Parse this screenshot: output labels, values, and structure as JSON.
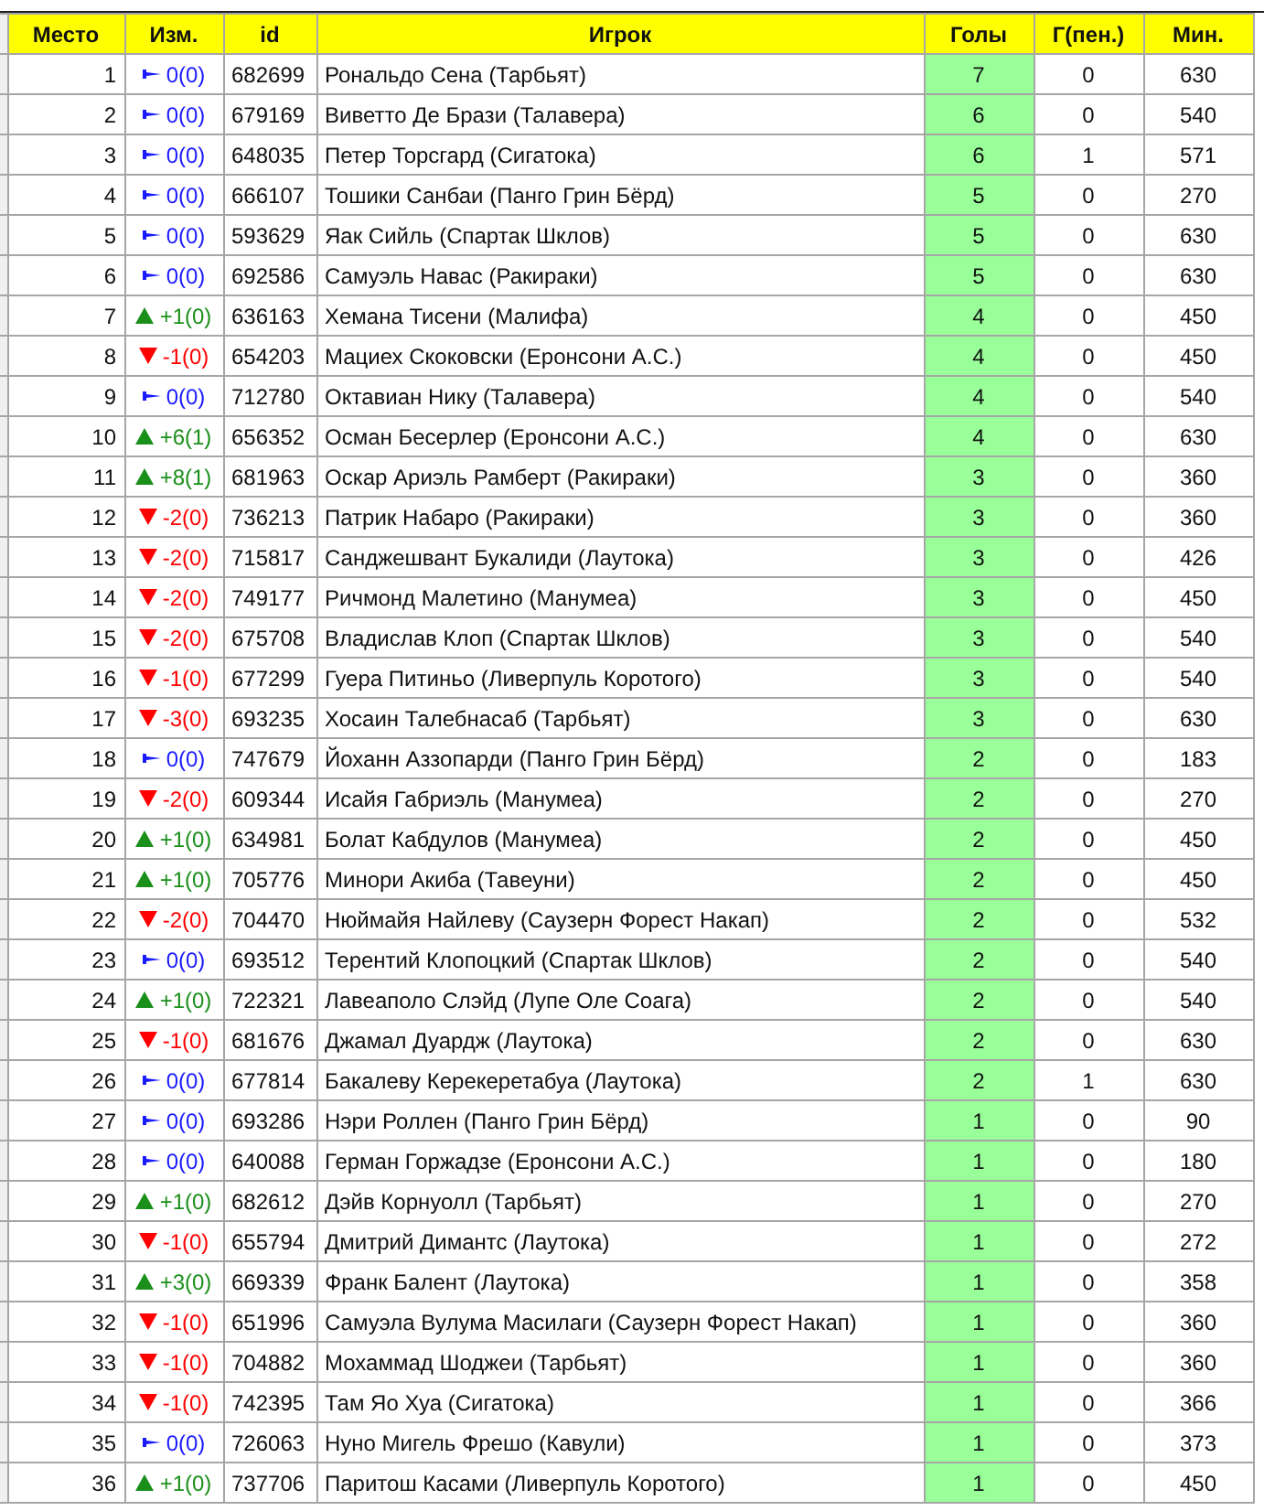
{
  "table": {
    "columns": [
      "Место",
      "Изм.",
      "id",
      "Игрок",
      "Голы",
      "Г(пен.)",
      "Мин."
    ],
    "rows": [
      {
        "place": "1",
        "kind": "same",
        "change": "0(0)",
        "id": "682699",
        "player": "Рональдо Сена (Тарбьят)",
        "goals": "7",
        "pen": "0",
        "min": "630"
      },
      {
        "place": "2",
        "kind": "same",
        "change": "0(0)",
        "id": "679169",
        "player": "Виветто Де Брази (Талавера)",
        "goals": "6",
        "pen": "0",
        "min": "540"
      },
      {
        "place": "3",
        "kind": "same",
        "change": "0(0)",
        "id": "648035",
        "player": "Петер Торсгард (Сигатока)",
        "goals": "6",
        "pen": "1",
        "min": "571"
      },
      {
        "place": "4",
        "kind": "same",
        "change": "0(0)",
        "id": "666107",
        "player": "Тошики Санбаи (Панго Грин Бёрд)",
        "goals": "5",
        "pen": "0",
        "min": "270"
      },
      {
        "place": "5",
        "kind": "same",
        "change": "0(0)",
        "id": "593629",
        "player": "Яак Сийль (Спартак Шклов)",
        "goals": "5",
        "pen": "0",
        "min": "630"
      },
      {
        "place": "6",
        "kind": "same",
        "change": "0(0)",
        "id": "692586",
        "player": "Самуэль Навас (Ракираки)",
        "goals": "5",
        "pen": "0",
        "min": "630"
      },
      {
        "place": "7",
        "kind": "up",
        "change": "+1(0)",
        "id": "636163",
        "player": "Хемана Тисени (Малифа)",
        "goals": "4",
        "pen": "0",
        "min": "450"
      },
      {
        "place": "8",
        "kind": "down",
        "change": "-1(0)",
        "id": "654203",
        "player": "Мациех Скоковски (Еронсони А.С.)",
        "goals": "4",
        "pen": "0",
        "min": "450"
      },
      {
        "place": "9",
        "kind": "same",
        "change": "0(0)",
        "id": "712780",
        "player": "Октавиан Нику (Талавера)",
        "goals": "4",
        "pen": "0",
        "min": "540"
      },
      {
        "place": "10",
        "kind": "up",
        "change": "+6(1)",
        "id": "656352",
        "player": "Осман Бесерлер (Еронсони А.С.)",
        "goals": "4",
        "pen": "0",
        "min": "630"
      },
      {
        "place": "11",
        "kind": "up",
        "change": "+8(1)",
        "id": "681963",
        "player": "Оскар Ариэль Рамберт (Ракираки)",
        "goals": "3",
        "pen": "0",
        "min": "360"
      },
      {
        "place": "12",
        "kind": "down",
        "change": "-2(0)",
        "id": "736213",
        "player": "Патрик Набаро (Ракираки)",
        "goals": "3",
        "pen": "0",
        "min": "360"
      },
      {
        "place": "13",
        "kind": "down",
        "change": "-2(0)",
        "id": "715817",
        "player": "Санджешвант Букалиди (Лаутока)",
        "goals": "3",
        "pen": "0",
        "min": "426"
      },
      {
        "place": "14",
        "kind": "down",
        "change": "-2(0)",
        "id": "749177",
        "player": "Ричмонд Малетино (Манумеа)",
        "goals": "3",
        "pen": "0",
        "min": "450"
      },
      {
        "place": "15",
        "kind": "down",
        "change": "-2(0)",
        "id": "675708",
        "player": "Владислав Клоп (Спартак Шклов)",
        "goals": "3",
        "pen": "0",
        "min": "540"
      },
      {
        "place": "16",
        "kind": "down",
        "change": "-1(0)",
        "id": "677299",
        "player": "Гуера Питиньо (Ливерпуль Коротого)",
        "goals": "3",
        "pen": "0",
        "min": "540"
      },
      {
        "place": "17",
        "kind": "down",
        "change": "-3(0)",
        "id": "693235",
        "player": "Хосаин Талебнасаб (Тарбьят)",
        "goals": "3",
        "pen": "0",
        "min": "630"
      },
      {
        "place": "18",
        "kind": "same",
        "change": "0(0)",
        "id": "747679",
        "player": "Йоханн Аззопарди (Панго Грин Бёрд)",
        "goals": "2",
        "pen": "0",
        "min": "183"
      },
      {
        "place": "19",
        "kind": "down",
        "change": "-2(0)",
        "id": "609344",
        "player": "Исайя Габриэль (Манумеа)",
        "goals": "2",
        "pen": "0",
        "min": "270"
      },
      {
        "place": "20",
        "kind": "up",
        "change": "+1(0)",
        "id": "634981",
        "player": "Болат Кабдулов (Манумеа)",
        "goals": "2",
        "pen": "0",
        "min": "450"
      },
      {
        "place": "21",
        "kind": "up",
        "change": "+1(0)",
        "id": "705776",
        "player": "Минори Акиба (Тавеуни)",
        "goals": "2",
        "pen": "0",
        "min": "450"
      },
      {
        "place": "22",
        "kind": "down",
        "change": "-2(0)",
        "id": "704470",
        "player": "Нюймайя Найлеву (Саузерн Форест Накап)",
        "goals": "2",
        "pen": "0",
        "min": "532"
      },
      {
        "place": "23",
        "kind": "same",
        "change": "0(0)",
        "id": "693512",
        "player": "Терентий Клопоцкий (Спартак Шклов)",
        "goals": "2",
        "pen": "0",
        "min": "540"
      },
      {
        "place": "24",
        "kind": "up",
        "change": "+1(0)",
        "id": "722321",
        "player": "Лавеаполо Слэйд (Лупе Оле Соага)",
        "goals": "2",
        "pen": "0",
        "min": "540"
      },
      {
        "place": "25",
        "kind": "down",
        "change": "-1(0)",
        "id": "681676",
        "player": "Джамал Дуардж (Лаутока)",
        "goals": "2",
        "pen": "0",
        "min": "630"
      },
      {
        "place": "26",
        "kind": "same",
        "change": "0(0)",
        "id": "677814",
        "player": "Бакалеву Керекеретабуа (Лаутока)",
        "goals": "2",
        "pen": "1",
        "min": "630"
      },
      {
        "place": "27",
        "kind": "same",
        "change": "0(0)",
        "id": "693286",
        "player": "Нэри Роллен (Панго Грин Бёрд)",
        "goals": "1",
        "pen": "0",
        "min": "90"
      },
      {
        "place": "28",
        "kind": "same",
        "change": "0(0)",
        "id": "640088",
        "player": "Герман Горжадзе (Еронсони А.С.)",
        "goals": "1",
        "pen": "0",
        "min": "180"
      },
      {
        "place": "29",
        "kind": "up",
        "change": "+1(0)",
        "id": "682612",
        "player": "Дэйв Корнуолл (Тарбьят)",
        "goals": "1",
        "pen": "0",
        "min": "270"
      },
      {
        "place": "30",
        "kind": "down",
        "change": "-1(0)",
        "id": "655794",
        "player": "Дмитрий Димантс (Лаутока)",
        "goals": "1",
        "pen": "0",
        "min": "272"
      },
      {
        "place": "31",
        "kind": "up",
        "change": "+3(0)",
        "id": "669339",
        "player": "Франк Балент (Лаутока)",
        "goals": "1",
        "pen": "0",
        "min": "358"
      },
      {
        "place": "32",
        "kind": "down",
        "change": "-1(0)",
        "id": "651996",
        "player": "Самуэла Вулума Масилаги (Саузерн Форест Накап)",
        "goals": "1",
        "pen": "0",
        "min": "360"
      },
      {
        "place": "33",
        "kind": "down",
        "change": "-1(0)",
        "id": "704882",
        "player": "Мохаммад Шоджеи (Тарбьят)",
        "goals": "1",
        "pen": "0",
        "min": "360"
      },
      {
        "place": "34",
        "kind": "down",
        "change": "-1(0)",
        "id": "742395",
        "player": "Там Яо Хуа (Сигатока)",
        "goals": "1",
        "pen": "0",
        "min": "366"
      },
      {
        "place": "35",
        "kind": "same",
        "change": "0(0)",
        "id": "726063",
        "player": "Нуно Мигель Фрешо (Кавули)",
        "goals": "1",
        "pen": "0",
        "min": "373"
      },
      {
        "place": "36",
        "kind": "up",
        "change": "+1(0)",
        "id": "737706",
        "player": "Паритош Касами (Ливерпуль Коротого)",
        "goals": "1",
        "pen": "0",
        "min": "450"
      }
    ]
  }
}
